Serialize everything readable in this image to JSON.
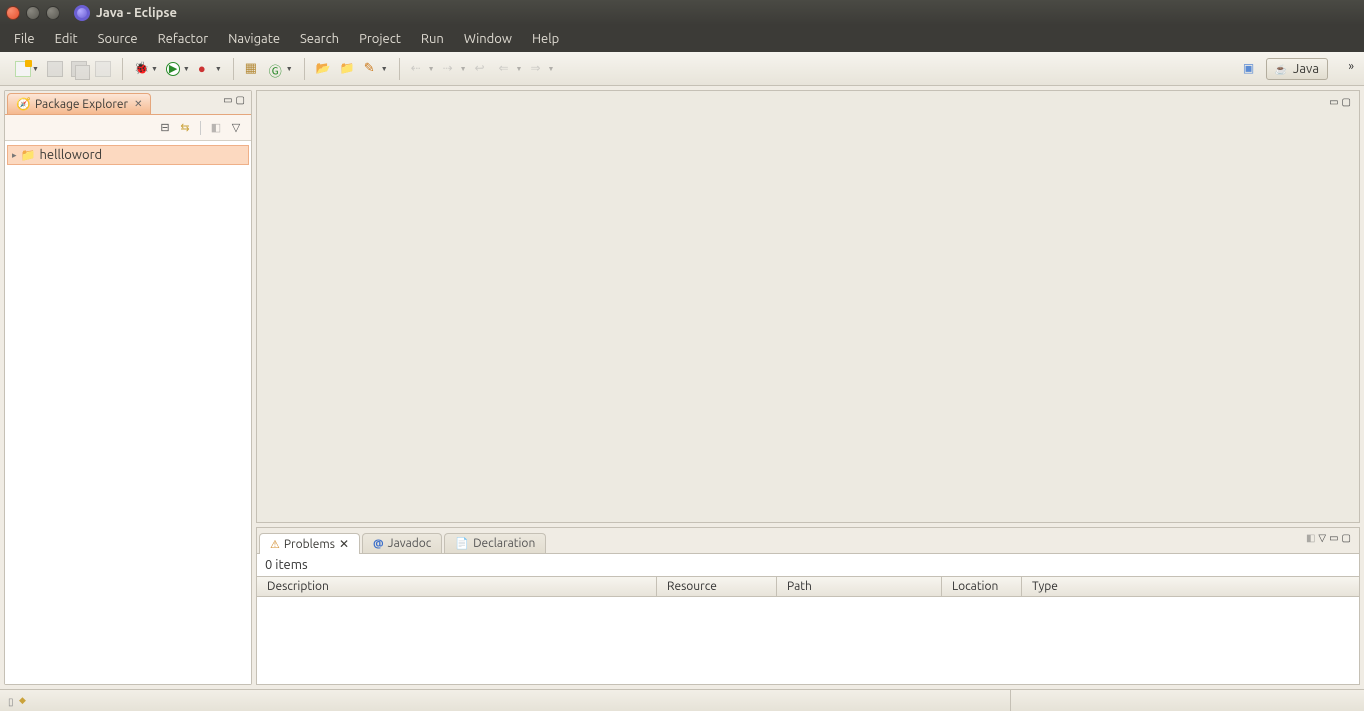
{
  "window": {
    "title": "Java - Eclipse"
  },
  "menu": {
    "items": [
      "File",
      "Edit",
      "Source",
      "Refactor",
      "Navigate",
      "Search",
      "Project",
      "Run",
      "Window",
      "Help"
    ]
  },
  "perspective": {
    "open_label": "",
    "active": "Java"
  },
  "package_explorer": {
    "title": "Package Explorer",
    "items": [
      {
        "label": "hellloword"
      }
    ]
  },
  "problems_view": {
    "tabs": [
      "Problems",
      "Javadoc",
      "Declaration"
    ],
    "active_tab": "Problems",
    "summary": "0 items",
    "columns": [
      "Description",
      "Resource",
      "Path",
      "Location",
      "Type"
    ]
  }
}
